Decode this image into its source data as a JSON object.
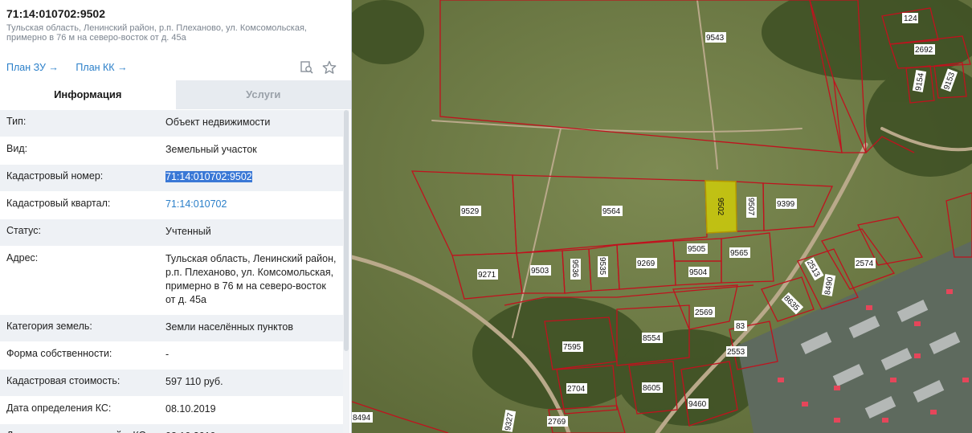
{
  "header": {
    "cadastral_number": "71:14:010702:9502",
    "address_line": "Тульская область, Ленинский район, р.п. Плеханово, ул. Комсомольская, примерно в 76 м на северо-восток от д. 45а"
  },
  "links": {
    "plan_zu": "План ЗУ →",
    "plan_kk": "План КК →"
  },
  "icons": {
    "search": "search-document-icon",
    "favorite": "star-icon"
  },
  "tabs": {
    "info": "Информация",
    "services": "Услуги"
  },
  "rows": [
    {
      "key": "Тип:",
      "value": "Объект недвижимости"
    },
    {
      "key": "Вид:",
      "value": "Земельный участок"
    },
    {
      "key": "Кадастровый номер:",
      "value": "71:14:010702:9502"
    },
    {
      "key": "Кадастровый квартал:",
      "value": "71:14:010702"
    },
    {
      "key": "Статус:",
      "value": "Учтенный"
    },
    {
      "key": "Адрес:",
      "value": "Тульская область, Ленинский район, р.п. Плеханово, ул. Комсомольская, примерно в 76 м на северо-восток от д. 45а"
    },
    {
      "key": "Категория земель:",
      "value": "Земли населённых пунктов"
    },
    {
      "key": "Форма собственности:",
      "value": "-"
    },
    {
      "key": "Кадастровая стоимость:",
      "value": "597 110 руб."
    },
    {
      "key": "Дата определения КС:",
      "value": "08.10.2019"
    },
    {
      "key": "Дата внесения сведений о КС:",
      "value": "08.10.2019"
    }
  ],
  "map": {
    "highlighted_plot": "9502",
    "plot_labels": [
      "9543",
      "9529",
      "9564",
      "9502",
      "9507",
      "9399",
      "9271",
      "9503",
      "9536",
      "9535",
      "9269",
      "9505",
      "9504",
      "9565",
      "2569",
      "8554",
      "7595",
      "2704",
      "8605",
      "9460",
      "2769",
      "9327",
      "8494",
      "2553",
      "83",
      "8635",
      "2513",
      "8490",
      "2574",
      "124",
      "2692",
      "9154",
      "9153"
    ],
    "colors": {
      "boundary": "#c0121e",
      "highlight_fill": "#d8d400"
    }
  }
}
